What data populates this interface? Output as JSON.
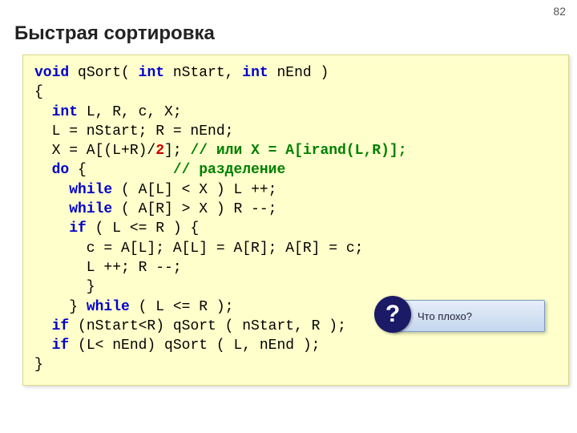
{
  "page_number": "82",
  "title": "Быстрая сортировка",
  "code": {
    "l1_kw1": "void",
    "l1_txt1": " qSort( ",
    "l1_kw2": "int",
    "l1_txt2": " nStart, ",
    "l1_kw3": "int",
    "l1_txt3": " nEnd )",
    "l2": "{",
    "l3_pad": "  ",
    "l3_kw": "int",
    "l3_txt": " L, R, c, X;",
    "l4": "  L = nStart; R = nEnd;",
    "l5_a": "  X = A[(L+R)/",
    "l5_num": "2",
    "l5_b": "]; ",
    "l5_cm": "// или X = A[irand(L,R)];",
    "l6_a": "  ",
    "l6_kw": "do",
    "l6_b": " {          ",
    "l6_cm": "// разделение",
    "l7_a": "    ",
    "l7_kw": "while",
    "l7_b": " ( A[L] < X ) L ++;",
    "l8_a": "    ",
    "l8_kw": "while",
    "l8_b": " ( A[R] > X ) R --;",
    "l9_a": "    ",
    "l9_kw": "if",
    "l9_b": " ( L <= R ) {",
    "l10": "      c = A[L]; A[L] = A[R]; A[R] = c;",
    "l11": "      L ++; R --;",
    "l12": "      }",
    "l13_a": "    } ",
    "l13_kw": "while",
    "l13_b": " ( L <= R );",
    "l14_a": "  ",
    "l14_kw": "if",
    "l14_b": " (nStart<R) qSort ( nStart, R );",
    "l15_a": "  ",
    "l15_kw": "if",
    "l15_b": " (L< nEnd) qSort ( L, nEnd );",
    "l16": "}"
  },
  "callout": {
    "badge": "?",
    "text": "Что плохо?"
  }
}
